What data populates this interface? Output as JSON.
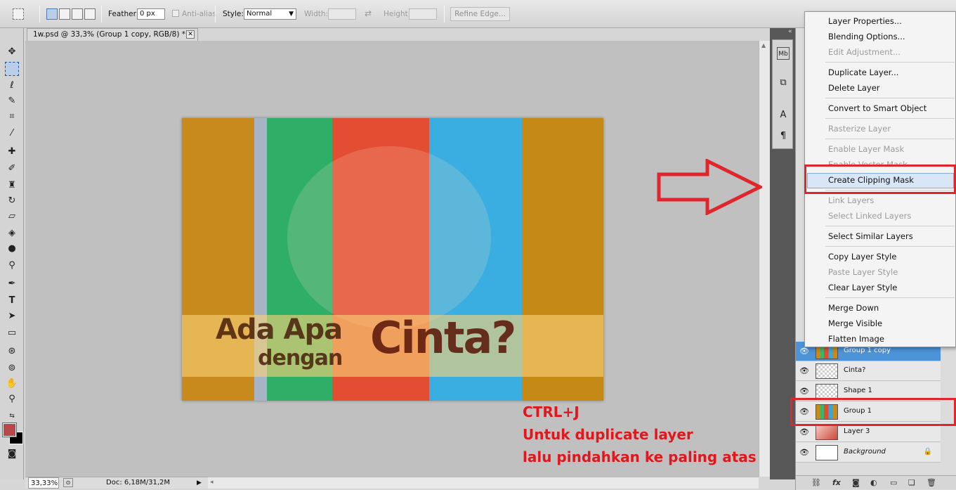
{
  "options_bar": {
    "feather_label": "Feather:",
    "feather_value": "0 px",
    "anti_alias_label": "Anti-alias",
    "style_label": "Style:",
    "style_value": "Normal",
    "width_label": "Width:",
    "height_label": "Height:",
    "refine_edge_label": "Refine Edge..."
  },
  "document_tab": {
    "title": "1w.psd @ 33,3% (Group 1 copy, RGB/8) *",
    "close_glyph": "✕"
  },
  "artwork": {
    "line1": "Ada Apa",
    "line2": "dengan",
    "line3": "Cinta?"
  },
  "status_bar": {
    "zoom": "33,33%",
    "doc_info": "Doc: 6,18M/31,2M"
  },
  "context_menu": {
    "items": [
      {
        "label": "Layer Properties...",
        "enabled": true
      },
      {
        "label": "Blending Options...",
        "enabled": true
      },
      {
        "label": "Edit Adjustment...",
        "enabled": false
      },
      {
        "label": "Duplicate Layer...",
        "enabled": true
      },
      {
        "label": "Delete Layer",
        "enabled": true
      },
      {
        "label": "Convert to Smart Object",
        "enabled": true
      },
      {
        "label": "Rasterize Layer",
        "enabled": false
      },
      {
        "label": "Enable Layer Mask",
        "enabled": false
      },
      {
        "label": "Enable Vector Mask",
        "enabled": false
      },
      {
        "label": "Create Clipping Mask",
        "enabled": true,
        "highlighted": true
      },
      {
        "label": "Link Layers",
        "enabled": false
      },
      {
        "label": "Select Linked Layers",
        "enabled": false
      },
      {
        "label": "Select Similar Layers",
        "enabled": true
      },
      {
        "label": "Copy Layer Style",
        "enabled": true
      },
      {
        "label": "Paste Layer Style",
        "enabled": false
      },
      {
        "label": "Clear Layer Style",
        "enabled": true
      },
      {
        "label": "Merge Down",
        "enabled": true
      },
      {
        "label": "Merge Visible",
        "enabled": true
      },
      {
        "label": "Flatten Image",
        "enabled": true
      }
    ]
  },
  "layers": [
    {
      "name": "Group 1 copy",
      "selected": true
    },
    {
      "name": "Cinta?",
      "selected": false
    },
    {
      "name": "Shape 1",
      "selected": false
    },
    {
      "name": "Group 1",
      "selected": false
    },
    {
      "name": "Layer 3",
      "selected": false
    },
    {
      "name": "Background",
      "selected": false,
      "locked": true
    }
  ],
  "annotation": {
    "line1": "CTRL+J",
    "line2": "Untuk duplicate layer",
    "line3": "lalu pindahkan ke paling atas",
    "color": "#e0181e"
  },
  "colors": {
    "foreground": "#b84747",
    "background": "#000000",
    "selected_layer": "#4c93d8"
  }
}
